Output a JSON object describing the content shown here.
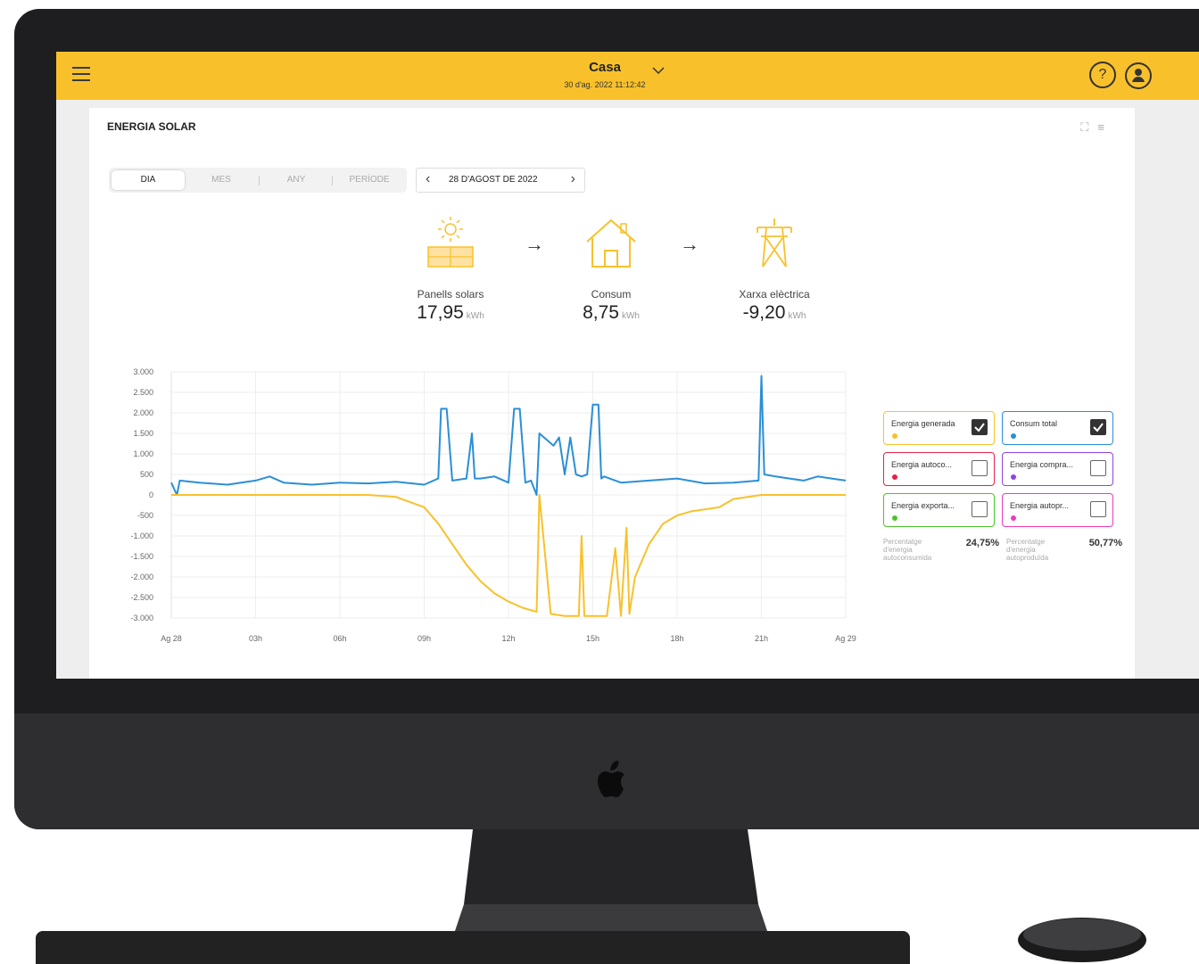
{
  "header": {
    "site_name": "Casa",
    "datetime": "30 d'ag. 2022 11:12:42",
    "help_label": "?"
  },
  "card": {
    "title": "ENERGIA SOLAR"
  },
  "period_tabs": [
    "DIA",
    "MES",
    "ANY",
    "PERÍODE"
  ],
  "active_tab": "DIA",
  "date_nav": {
    "label": "28 D'AGOST DE 2022"
  },
  "flows": [
    {
      "label": "Panells solars",
      "value": "17,95",
      "unit": "kWh"
    },
    {
      "label": "Consum",
      "value": "8,75",
      "unit": "kWh"
    },
    {
      "label": "Xarxa elèctrica",
      "value": "-9,20",
      "unit": "kWh"
    }
  ],
  "legend": [
    {
      "label": "Energia generada",
      "color": "#f8c12c",
      "checked": true
    },
    {
      "label": "Consum total",
      "color": "#2a8fd6",
      "checked": true
    },
    {
      "label": "Energia autoco...",
      "color": "#e8214a",
      "checked": false
    },
    {
      "label": "Energia compra...",
      "color": "#8e44e0",
      "checked": false
    },
    {
      "label": "Energia exporta...",
      "color": "#4cc42c",
      "checked": false
    },
    {
      "label": "Energia autopr...",
      "color": "#e83cc4",
      "checked": false
    }
  ],
  "percentages": [
    {
      "label": "Percentatge d'energia autoconsumida",
      "value": "24,75%"
    },
    {
      "label": "Percentatge d'energia autoproduïda",
      "value": "50,77%"
    }
  ],
  "chart_data": {
    "type": "line",
    "x_tick_labels": [
      "Ag 28",
      "03h",
      "06h",
      "09h",
      "12h",
      "15h",
      "18h",
      "21h",
      "Ag 29"
    ],
    "y_tick_labels": [
      "3.000",
      "2.500",
      "2.000",
      "1.500",
      "1.000",
      "500",
      "0",
      "-500",
      "-1.000",
      "-1.500",
      "-2.000",
      "-2.500",
      "-3.000"
    ],
    "ylim": [
      -3000,
      3000
    ],
    "xlim": [
      0,
      24
    ],
    "series": [
      {
        "color": "#2a8fd6",
        "x": [
          0,
          0.2,
          0.3,
          1,
          2,
          3,
          3.5,
          4,
          5,
          6,
          7,
          8,
          9,
          9.5,
          9.6,
          9.8,
          10,
          10.5,
          10.7,
          10.8,
          11,
          11.5,
          12,
          12.2,
          12.4,
          12.6,
          12.8,
          13,
          13.1,
          13.6,
          13.8,
          14,
          14.2,
          14.4,
          14.6,
          14.8,
          15,
          15.2,
          15.3,
          15.4,
          15.6,
          16,
          17,
          18,
          19,
          20,
          20.9,
          21.0,
          21.1,
          21.5,
          22,
          22.5,
          23,
          23.5,
          24
        ],
        "y": [
          300,
          0,
          350,
          300,
          250,
          350,
          450,
          300,
          250,
          300,
          280,
          320,
          250,
          400,
          2100,
          2100,
          350,
          400,
          1500,
          400,
          400,
          450,
          300,
          2100,
          2100,
          300,
          350,
          0,
          1500,
          1200,
          1400,
          500,
          1400,
          500,
          450,
          500,
          2200,
          2200,
          400,
          450,
          400,
          300,
          350,
          400,
          280,
          300,
          350,
          2900,
          500,
          450,
          400,
          350,
          450,
          400,
          350
        ]
      },
      {
        "color": "#f8c12c",
        "x": [
          0,
          7,
          8,
          9,
          9.5,
          10,
          10.5,
          11,
          11.5,
          12,
          12.5,
          13,
          13.1,
          13.5,
          14,
          14.5,
          14.6,
          14.7,
          15,
          15.5,
          15.8,
          16,
          16.2,
          16.3,
          16.5,
          17,
          17.5,
          18,
          18.5,
          19,
          19.5,
          20,
          21,
          22,
          23,
          24
        ],
        "y": [
          0,
          0,
          -50,
          -300,
          -700,
          -1200,
          -1700,
          -2100,
          -2400,
          -2600,
          -2750,
          -2850,
          0,
          -2900,
          -2950,
          -2950,
          -1000,
          -2950,
          -2950,
          -2950,
          -1300,
          -2950,
          -800,
          -2900,
          -2000,
          -1200,
          -700,
          -500,
          -400,
          -350,
          -300,
          -100,
          0,
          0,
          0,
          0
        ]
      }
    ]
  }
}
